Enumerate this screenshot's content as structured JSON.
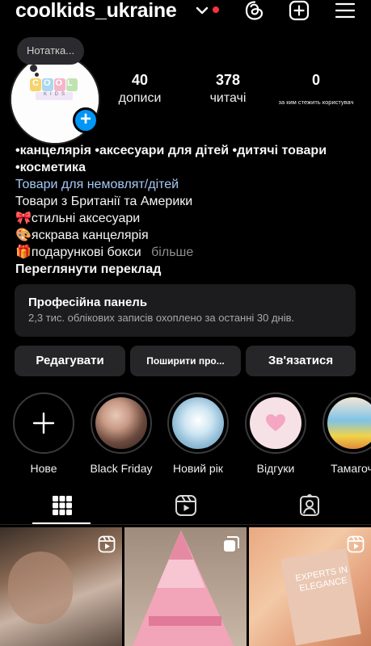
{
  "header": {
    "username": "coolkids_ukraine",
    "accent_notification": "#ff3040",
    "icons": [
      "chevron-down-icon",
      "threads-icon",
      "create-plus-icon",
      "menu-icon"
    ]
  },
  "profile": {
    "note_text": "Нотатка...",
    "avatar_logo_text": "COOL",
    "avatar_logo_sub": "KIDS",
    "stats": [
      {
        "value": "40",
        "label": "дописи"
      },
      {
        "value": "378",
        "label": "читачі"
      },
      {
        "value": "0",
        "label": "за ким стежить користувач"
      }
    ]
  },
  "bio": {
    "line1": "•канцелярія •аксесуари для дітей •дитячі товари",
    "line2": "•косметика",
    "category": "Товари для немовлят/дітей",
    "line3": "Товари з Британії та Америки",
    "line4": "🎀стильні аксесуари",
    "line5": "🎨яскрава канцелярія",
    "line6": "🎁подарункові бокси",
    "more": "більше",
    "translate": "Переглянути переклад"
  },
  "pro_panel": {
    "title": "Професійна панель",
    "subtitle": "2,3 тис. облікових записів охоплено за останні 30 днів."
  },
  "buttons": {
    "edit": "Редагувати",
    "share": "Поширити про...",
    "contact": "Зв'язатися"
  },
  "highlights": [
    {
      "label": "Нове",
      "icon": "plus-icon"
    },
    {
      "label": "Black Friday"
    },
    {
      "label": "Новий рік"
    },
    {
      "label": "Відгуки"
    },
    {
      "label": "Тамагочі"
    }
  ],
  "tabs": [
    "grid-icon",
    "reels-icon",
    "tagged-icon"
  ],
  "grid": [
    {
      "type": "reel",
      "icon": "reel-badge-icon"
    },
    {
      "type": "carousel",
      "icon": "carousel-badge-icon"
    },
    {
      "type": "reel",
      "icon": "reel-badge-icon",
      "text": "EXPERTS IN ELEGANCE"
    }
  ]
}
